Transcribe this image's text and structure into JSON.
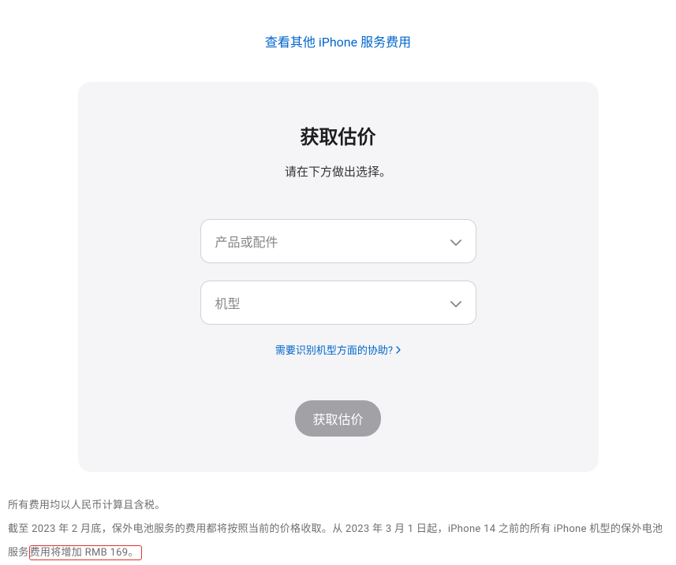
{
  "topLink": "查看其他 iPhone 服务费用",
  "card": {
    "title": "获取估价",
    "subtitle": "请在下方做出选择。",
    "select1Placeholder": "产品或配件",
    "select2Placeholder": "机型",
    "helpLink": "需要识别机型方面的协助?",
    "submitLabel": "获取估价"
  },
  "footer": {
    "line1": "所有费用均以人民币计算且含税。",
    "line2Part1": "截至 2023 年 2 月底，保外电池服务的费用都将按照当前的价格收取。从 2023 年 3 月 1 日起，iPhone 14 之前的所有 iPhone 机型的保外电池服务",
    "line2Highlight": "费用将增加 RMB 169。"
  }
}
